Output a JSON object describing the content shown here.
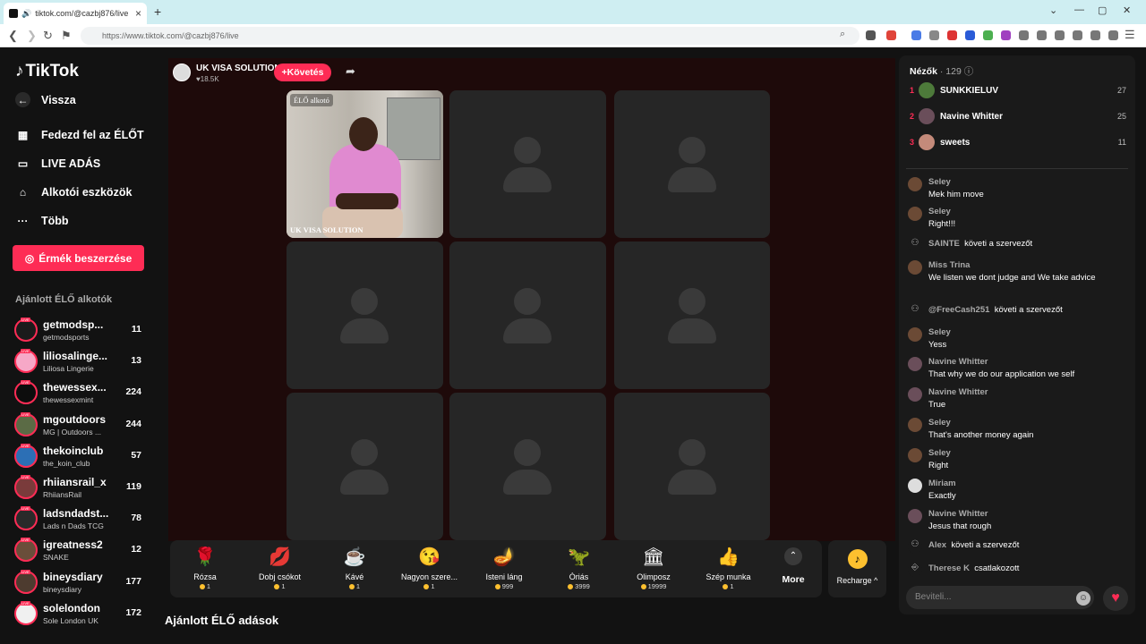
{
  "browser": {
    "tab_title": "tiktok.com/@cazbj876/live",
    "url": "https://www.tiktok.com/@cazbj876/live"
  },
  "sidebar": {
    "logo": "TikTok",
    "back": "Vissza",
    "nav": [
      "Fedezd fel az ÉLŐT",
      "LIVE ADÁS",
      "Alkotói eszközök",
      "Több"
    ],
    "coins_button": "Érmék beszerzése",
    "recommended_title": "Ajánlott ÉLŐ alkotók",
    "creators": [
      {
        "name": "getmodsp...",
        "sub": "getmodsports",
        "count": "11",
        "color": "#1b1b1b"
      },
      {
        "name": "liliosalinge...",
        "sub": "Liliosa Lingerie",
        "count": "13",
        "color": "#f6a8c7"
      },
      {
        "name": "thewessex...",
        "sub": "thewessexmint",
        "count": "224",
        "color": "#0d0d0d"
      },
      {
        "name": "mgoutdoors",
        "sub": "MG | Outdoors ...",
        "count": "244",
        "color": "#5b6b45"
      },
      {
        "name": "thekoinclub",
        "sub": "the_koin_club",
        "count": "57",
        "color": "#2c6fb5"
      },
      {
        "name": "rhiiansrail_x",
        "sub": "RhiiansRail",
        "count": "119",
        "color": "#7a3b3b"
      },
      {
        "name": "ladsndadst...",
        "sub": "Lads n Dads TCG",
        "count": "78",
        "color": "#2a2a2a"
      },
      {
        "name": "igreatness2",
        "sub": "SNAKE",
        "count": "12",
        "color": "#6a4e3a"
      },
      {
        "name": "bineysdiary",
        "sub": "bineysdiary",
        "count": "177",
        "color": "#4d3b2f"
      },
      {
        "name": "solelondon",
        "sub": "Sole London UK",
        "count": "172",
        "color": "#f0f0f0"
      }
    ]
  },
  "host": {
    "name": "UK VISA SOLUTION",
    "likes": "♥18.5K",
    "follow": "+Követés"
  },
  "stage": {
    "tag": "ÉLŐ alkotó",
    "slot_name": "UK VISA SOLUTION"
  },
  "gifts": [
    {
      "name": "Rózsa",
      "price": "1",
      "icon": "🌹"
    },
    {
      "name": "Dobj csókot",
      "price": "1",
      "icon": "💋"
    },
    {
      "name": "Kávé",
      "price": "1",
      "icon": "☕"
    },
    {
      "name": "Nagyon szere...",
      "price": "1",
      "icon": "😘"
    },
    {
      "name": "Isteni láng",
      "price": "999",
      "icon": "🪔"
    },
    {
      "name": "Óriás",
      "price": "3999",
      "icon": "🦖"
    },
    {
      "name": "Olimposz",
      "price": "19999",
      "icon": "🏛"
    },
    {
      "name": "Szép munka",
      "price": "1",
      "icon": "👍"
    }
  ],
  "more_label": "More",
  "recharge_label": "Recharge ^",
  "recommended_live": "Ajánlott ÉLŐ adások",
  "chat": {
    "viewers_label": "Nézők",
    "viewers_count": "· 129",
    "top_viewers": [
      {
        "rank": "1",
        "name": "SUNKKIELUV",
        "score": "27",
        "color": "#4d7a3a"
      },
      {
        "rank": "2",
        "name": "Navine Whitter",
        "score": "25",
        "color": "#6a4e5a"
      },
      {
        "rank": "3",
        "name": "sweets",
        "score": "11",
        "color": "#c48a7a"
      }
    ],
    "messages": [
      {
        "user": "Seley",
        "text": "Mek him move"
      },
      {
        "user": "Seley",
        "text": "Right!!!"
      },
      {
        "user": "SAINTE",
        "text": "követi a szervezőt"
      },
      {
        "user": "Miss Trina",
        "text": "We listen we dont judge and We take advice"
      },
      {
        "user": "@FreeCash251",
        "text": "követi a szervezőt"
      },
      {
        "user": "Seley",
        "text": "Yess"
      },
      {
        "user": "Navine Whitter",
        "text": "That why we do our application we self"
      },
      {
        "user": "Navine Whitter",
        "text": "True"
      },
      {
        "user": "Seley",
        "text": "That's another money again"
      },
      {
        "user": "Seley",
        "text": "Right"
      },
      {
        "user": "Miriam",
        "text": "Exactly"
      },
      {
        "user": "Navine Whitter",
        "text": "Jesus that rough"
      },
      {
        "user": "Alex",
        "text": "követi a szervezőt"
      },
      {
        "user": "Therese K",
        "text": "csatlakozott"
      }
    ],
    "input_placeholder": "Beviteli..."
  }
}
